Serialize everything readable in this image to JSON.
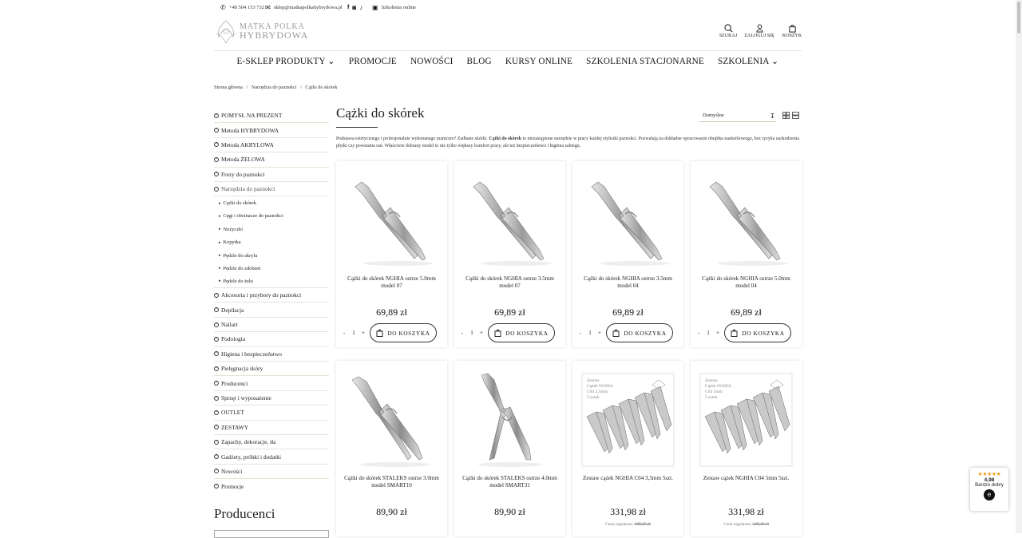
{
  "topbar": {
    "phone": "+48 504 153 732",
    "email": "sklep@matkapolkahybrydowa.pl",
    "online": "Szkolenia online"
  },
  "logo": {
    "line1": "MATKA POLKA",
    "line2": "HYBRYDOWA"
  },
  "header_icons": {
    "search": "SZUKAJ",
    "login": "ZALOGUJ SIĘ",
    "cart": "KOSZYK"
  },
  "nav": [
    "E-SKLEP PRODUKTY ⌄",
    "PROMOCJE",
    "NOWOŚCI",
    "BLOG",
    "KURSY ONLINE",
    "SZKOLENIA STACJONARNE",
    "SZKOLENIA ⌄"
  ],
  "breadcrumbs": [
    "Strona główna",
    "/",
    "Narzędzia do paznokci",
    "/",
    "Cążki do skórek"
  ],
  "sidebar": {
    "cats_top": [
      "POMYSŁ NA PREZENT",
      "Metoda HYBRYDOWA",
      "Metoda AKRYLOWA",
      "Metoda ŻELOWA",
      "Frezy do paznokci",
      "Narzędzia do paznokci"
    ],
    "subs": [
      "Cążki do skórek",
      "Cęgi i obcinacze do paznokci",
      "Nożyczki",
      "Kopytka",
      "Pędzle do akrylu",
      "Pędzle do zdobień",
      "Pędzle do żelu"
    ],
    "cats_bottom": [
      "Akcesoria i przybory do paznokci",
      "Depilacja",
      "Nailart",
      "Podologia",
      "Higiena i bezpieczeństwo",
      "Pielęgnacja skóry",
      "Producenci",
      "Sprzęt i wyposażenie",
      "OUTLET",
      "ZESTAWY",
      "Zapachy, dekoracje, tła",
      "Gadżety, próbki i dodatki",
      "Nowości",
      "Promocje"
    ],
    "heading": "Producenci"
  },
  "page": {
    "title": "Cążki do skórek",
    "sort": "Domyślne",
    "desc_a": "Podstawa estetycznego i profesjonalnie wykonanego manicure? Zadbane skórki. ",
    "desc_b": "Cążki do skórek",
    "desc_c": " to niezastąpione narzędzie w pracy każdej stylistki paznokci. Pozwalają na dokładne opracowanie obrąbka naskórkowego, bez ryzyka uszkodzenia płytki czy powstania ran. Właściwie dobrany model to nie tylko większy komfort pracy, ale też bezpieczeństwo i higiena zabiegu."
  },
  "products": [
    {
      "name": "Cążki do skórek NGHIA ostrze 5.0mm model 07",
      "price": "69,89 zł",
      "qty": "1",
      "btn": "DO KOSZYKA"
    },
    {
      "name": "Cążki do skórek NGHIA ostrze 3.5mm model 07",
      "price": "69,89 zł",
      "qty": "1",
      "btn": "DO KOSZYKA"
    },
    {
      "name": "Cążki do skórek NGHIA ostrze 3.5mm model 04",
      "price": "69,89 zł",
      "qty": "1",
      "btn": "DO KOSZYKA"
    },
    {
      "name": "Cążki do skórek NGHIA ostrze 5.0mm model 04",
      "price": "69,89 zł",
      "qty": "1",
      "btn": "DO KOSZYKA"
    },
    {
      "name": "Cążki do skórek STALEKS ostrze 3.0mm model SMART10",
      "price": "89,90 zł"
    },
    {
      "name": "Cążki do skórek STALEKS ostrze 4.0mm model SMART31",
      "price": "89,90 zł"
    },
    {
      "name": "Zestaw cążek NGHIA C04 3,5mm 5szt.",
      "price": "331,98 zł",
      "reg_label": "Cena regularna:",
      "reg": "349,45 zł",
      "img_text": "Zestaw Cążek NGHIA C04 3,5mm 5 sztuk"
    },
    {
      "name": "Zestaw cążek NGHIA C04 5mm 5szt.",
      "price": "331,98 zł",
      "reg_label": "Cena regularna:",
      "reg": "349,45 zł",
      "img_text": "Zestaw Cążek NGHIA C04 5mm 5 sztuk"
    }
  ],
  "badge": {
    "stars": "★★★★★",
    "score": "4,98",
    "label": "Bardzo dobry",
    "logo": "e"
  }
}
